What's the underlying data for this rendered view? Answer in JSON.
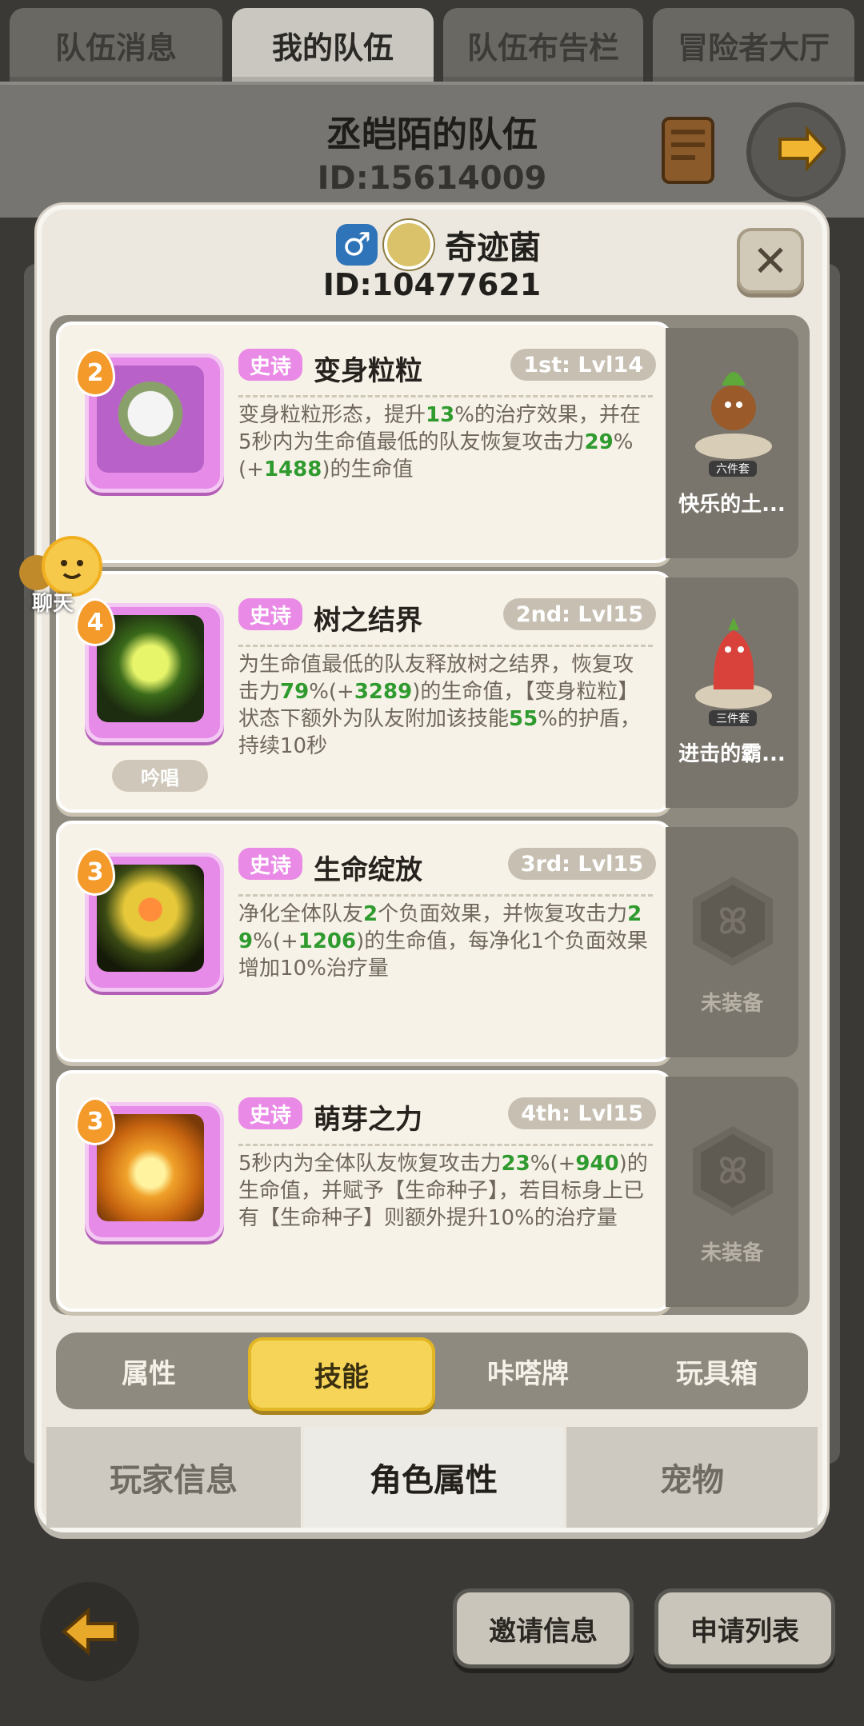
{
  "top_tabs": [
    {
      "label": "队伍消息",
      "active": false
    },
    {
      "label": "我的队伍",
      "active": true
    },
    {
      "label": "队伍布告栏",
      "active": false
    },
    {
      "label": "冒险者大厅",
      "active": false
    }
  ],
  "team": {
    "title": "丞皑陌的队伍",
    "id": "ID:15614009"
  },
  "player": {
    "gender_icon": "male-symbol-icon",
    "name": "奇迹菌",
    "id": "ID:10477621"
  },
  "skills": [
    {
      "level": "2",
      "rarity": "史诗",
      "name": "变身粒粒",
      "slot": "1st: Lvl14",
      "desc_parts": [
        "变身粒粒形态，提升",
        "13",
        "%的治疗效果，并在5秒内为生命值最低的队友恢复攻击力",
        "29",
        "%(+",
        "1488",
        ")的生命值"
      ],
      "tag": "",
      "equip": {
        "label": "快乐的土...",
        "set": "六件套",
        "equipped": true
      }
    },
    {
      "level": "4",
      "rarity": "史诗",
      "name": "树之结界",
      "slot": "2nd: Lvl15",
      "desc_parts": [
        "为生命值最低的队友释放树之结界，恢复攻击力",
        "79",
        "%(+",
        "3289",
        ")的生命值，【变身粒粒】状态下额外为队友附加该技能",
        "55",
        "%的护盾，持续10秒"
      ],
      "tag": "吟唱",
      "equip": {
        "label": "进击的霸...",
        "set": "三件套",
        "equipped": true
      }
    },
    {
      "level": "3",
      "rarity": "史诗",
      "name": "生命绽放",
      "slot": "3rd: Lvl15",
      "desc_parts": [
        "净化全体队友",
        "2",
        "个负面效果，并恢复攻击力",
        "29",
        "%(+",
        "1206",
        ")的生命值，每净化1个负面效果增加10%治疗量"
      ],
      "tag": "",
      "equip": {
        "label": "未装备",
        "set": "",
        "equipped": false
      }
    },
    {
      "level": "3",
      "rarity": "史诗",
      "name": "萌芽之力",
      "slot": "4th: Lvl15",
      "desc_parts": [
        "5秒内为全体队友恢复攻击力",
        "23",
        "%(+",
        "940",
        ")的生命值，并赋予【生命种子】，若目标身上已有【生命种子】则额外提升10%的治疗量"
      ],
      "tag": "",
      "equip": {
        "label": "未装备",
        "set": "",
        "equipped": false
      }
    }
  ],
  "inner_tabs": [
    {
      "label": "属性",
      "active": false
    },
    {
      "label": "技能",
      "active": true
    },
    {
      "label": "咔嗒牌",
      "active": false
    },
    {
      "label": "玩具箱",
      "active": false
    }
  ],
  "bottom_tabs": [
    {
      "label": "玩家信息",
      "active": false
    },
    {
      "label": "角色属性",
      "active": true
    },
    {
      "label": "宠物",
      "active": false
    }
  ],
  "chat_label": "聊天",
  "footer": {
    "invite": "邀请信息",
    "apply": "申请列表"
  },
  "colors": {
    "rarity": "#e98ae6",
    "highlight": "#2f9b2f",
    "active_tab": "#f5d457"
  }
}
